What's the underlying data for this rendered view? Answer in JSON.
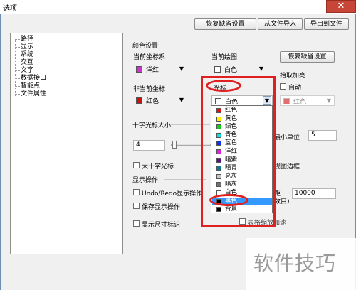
{
  "window": {
    "title": "选项",
    "close_glyph": "✕"
  },
  "top_buttons": {
    "restore_defaults": "恢复缺省设置",
    "import_from_file": "从文件导入",
    "export_to_file": "导出到文件"
  },
  "tree": {
    "items": [
      "路径",
      "显示",
      "系统",
      "交互",
      "文字",
      "数据接口",
      "智能点",
      "文件属性"
    ]
  },
  "colors": {
    "section_title": "颜色设置",
    "current_axis_label": "当前坐标系",
    "current_axis_value": "洋红",
    "current_axis_swatch": "#cc33cc",
    "current_draw_label": "当前绘图",
    "current_draw_value": "白色",
    "current_draw_swatch": "#ffffff",
    "restore_button": "恢复缺省设置",
    "noncurrent_axis_label": "非当前坐标",
    "noncurrent_axis_value": "红色",
    "noncurrent_axis_swatch": "#cc1111",
    "cursor_label": "光标",
    "cursor_value": "白色",
    "cursor_swatch": "#ffffff",
    "pick_highlight_label": "拾取加亮",
    "auto_label": "自动",
    "pick_value": "红色",
    "pick_swatch": "#e07070"
  },
  "cursor_size": {
    "section_title": "十字光标大小",
    "value": "4",
    "slider_level": 0.03
  },
  "right_partial": {
    "min_unit_label": "最小单位",
    "min_unit_value": "5"
  },
  "big_cursor": {
    "label": "大十字光标",
    "border_label": "视图边框"
  },
  "display_ops": {
    "section_title": "显示操作",
    "undo_redo_label": "Undo/Redo显示操作",
    "save_display_label": "保存显示操作",
    "distance_label_1": "距",
    "distance_label_2": "数目)",
    "distance_value": "10000",
    "show_size_label": "显示尺寸标识",
    "bottom_partial_label": "表格缩放加速"
  },
  "dropdown": {
    "items": [
      {
        "name": "红色",
        "color": "#dd1111",
        "selected": false
      },
      {
        "name": "黄色",
        "color": "#ffee00",
        "selected": false
      },
      {
        "name": "绿色",
        "color": "#11cc11",
        "selected": false
      },
      {
        "name": "青色",
        "color": "#11dddd",
        "selected": false
      },
      {
        "name": "蓝色",
        "color": "#1133ee",
        "selected": false
      },
      {
        "name": "洋红",
        "color": "#dd22dd",
        "selected": false
      },
      {
        "name": "暗紫",
        "color": "#551188",
        "selected": false
      },
      {
        "name": "暗青",
        "color": "#117788",
        "selected": false
      },
      {
        "name": "亮灰",
        "color": "#c8c8c8",
        "selected": false
      },
      {
        "name": "暗灰",
        "color": "#707070",
        "selected": false
      },
      {
        "name": "白色",
        "color": "#ffffff",
        "selected": false
      },
      {
        "name": "黑色",
        "color": "#000000",
        "selected": true
      },
      {
        "name": "背景",
        "color": "#000000",
        "selected": false
      }
    ]
  },
  "watermark": {
    "text": "软件技巧"
  },
  "annotation_color": "#e02020"
}
